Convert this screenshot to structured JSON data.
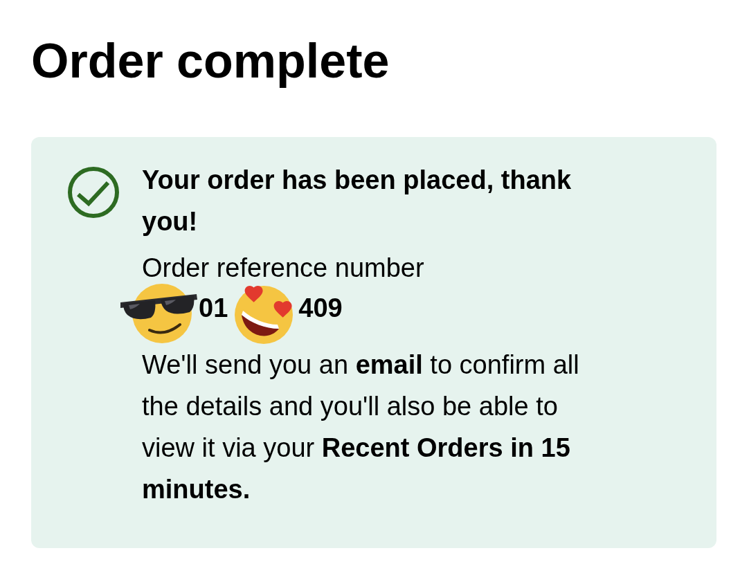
{
  "page": {
    "title": "Order complete"
  },
  "confirmation": {
    "heading": "Your order has been placed, thank you!",
    "reference_label": "Order reference number",
    "reference_number_visible_parts": [
      "01",
      "409"
    ],
    "message": "We'll send you an **email** to confirm all the details and you'll also be able to view it via your **Recent Orders in 15 minutes.**"
  }
}
